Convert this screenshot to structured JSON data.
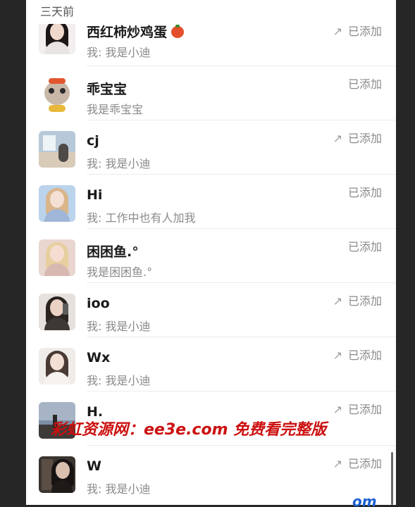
{
  "section": {
    "title": "三天前"
  },
  "colors": {
    "background": "#262626",
    "panel": "#ffffff",
    "name_text": "#1a1a1a",
    "secondary_text": "#8a8a8a",
    "watermark": "#cc1010"
  },
  "contacts": [
    {
      "name": "西红柿炒鸡蛋",
      "message": "我: 我是小迪",
      "status": "已添加",
      "has_arrow": true,
      "emoji": "tomato-icon",
      "avatar": "avatar-girl-dark-hair"
    },
    {
      "name": "乖宝宝",
      "message": "我是乖宝宝",
      "status": "已添加",
      "has_arrow": false,
      "avatar": "avatar-cartoon-cat"
    },
    {
      "name": "cj",
      "message": "我: 我是小迪",
      "status": "已添加",
      "has_arrow": true,
      "avatar": "avatar-room-photo"
    },
    {
      "name": "Hi",
      "message": "我: 工作中也有人加我",
      "status": "已添加",
      "has_arrow": false,
      "avatar": "avatar-anime-girl"
    },
    {
      "name": "困困鱼.°",
      "message": "我是困困鱼.°",
      "status": "已添加",
      "has_arrow": false,
      "avatar": "avatar-blonde-girl"
    },
    {
      "name": "ioo",
      "message": "我: 我是小迪",
      "status": "已添加",
      "has_arrow": true,
      "avatar": "avatar-mirror-selfie"
    },
    {
      "name": "Wx",
      "message": "我: 我是小迪",
      "status": "已添加",
      "has_arrow": true,
      "avatar": "avatar-portrait-light"
    },
    {
      "name": "H.",
      "message": "",
      "status": "已添加",
      "has_arrow": true,
      "avatar": "avatar-landscape"
    },
    {
      "name": "W",
      "message": "我: 我是小迪",
      "status": "已添加",
      "has_arrow": true,
      "avatar": "avatar-dark-portrait"
    }
  ],
  "watermark": {
    "text": "彩虹资源网：ee3e.com 免费看完整版"
  },
  "corner_mark": {
    "text": "om"
  }
}
